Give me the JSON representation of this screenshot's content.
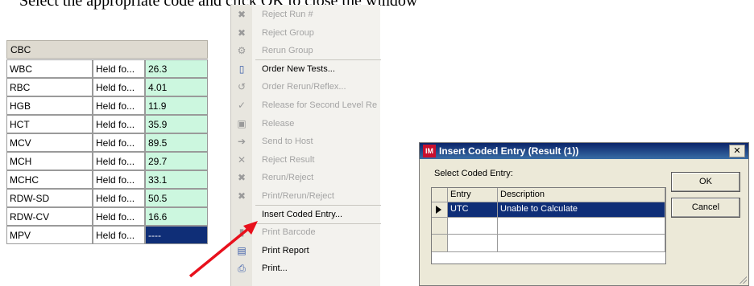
{
  "instruction": "Select the appropriate code and click OK to close the window",
  "cbc_panel": {
    "header": "CBC",
    "rows": [
      {
        "name": "WBC",
        "status": "Held fo...",
        "value": "26.3"
      },
      {
        "name": "RBC",
        "status": "Held fo...",
        "value": "4.01"
      },
      {
        "name": "HGB",
        "status": "Held fo...",
        "value": "11.9"
      },
      {
        "name": "HCT",
        "status": "Held fo...",
        "value": "35.9"
      },
      {
        "name": "MCV",
        "status": "Held fo...",
        "value": "89.5"
      },
      {
        "name": "MCH",
        "status": "Held fo...",
        "value": "29.7"
      },
      {
        "name": "MCHC",
        "status": "Held fo...",
        "value": "33.1"
      },
      {
        "name": "RDW-SD",
        "status": "Held fo...",
        "value": "50.5"
      },
      {
        "name": "RDW-CV",
        "status": "Held fo...",
        "value": "16.6"
      },
      {
        "name": "MPV",
        "status": "Held fo...",
        "value": "----",
        "selected": true
      }
    ]
  },
  "context_menu": {
    "items": [
      {
        "label": "Reject Run #",
        "enabled": false,
        "icon": "reject-run-icon",
        "glyph": "✖"
      },
      {
        "label": "Reject Group",
        "enabled": false,
        "icon": "reject-group-icon",
        "glyph": "✖"
      },
      {
        "label": "Rerun Group",
        "enabled": false,
        "icon": "rerun-group-icon",
        "glyph": "⚙"
      },
      {
        "label": "Order New Tests...",
        "enabled": true,
        "icon": "new-document-icon",
        "glyph": "▯"
      },
      {
        "label": "Order Rerun/Reflex...",
        "enabled": false,
        "icon": "rerun-reflex-icon",
        "glyph": "↺"
      },
      {
        "label": "Release for Second Level Re",
        "enabled": false,
        "icon": "checkmark-icon",
        "glyph": "✓"
      },
      {
        "label": "Release",
        "enabled": false,
        "icon": "release-icon",
        "glyph": "▣"
      },
      {
        "label": "Send to Host",
        "enabled": false,
        "icon": "send-to-host-icon",
        "glyph": "➔"
      },
      {
        "label": "Reject Result",
        "enabled": false,
        "icon": "reject-result-icon",
        "glyph": "✕"
      },
      {
        "label": "Rerun/Reject",
        "enabled": false,
        "icon": "rerun-reject-icon",
        "glyph": "✖"
      },
      {
        "label": "Print/Rerun/Reject",
        "enabled": false,
        "icon": "print-rerun-reject-icon",
        "glyph": "✖"
      },
      {
        "label": "Insert Coded Entry...",
        "enabled": true,
        "icon": "",
        "glyph": ""
      },
      {
        "label": "Print Barcode",
        "enabled": false,
        "icon": "barcode-icon",
        "glyph": "▮"
      },
      {
        "label": "Print Report",
        "enabled": true,
        "icon": "print-report-icon",
        "glyph": "▤"
      },
      {
        "label": "Print...",
        "enabled": true,
        "icon": "printer-icon",
        "glyph": "⎙"
      }
    ]
  },
  "dialog": {
    "app_icon_text": "IM",
    "title": "Insert Coded Entry (Result (1))",
    "close_label": "✕",
    "prompt": "Select Coded Entry:",
    "columns": [
      "Entry",
      "Description"
    ],
    "rows": [
      {
        "entry": "UTC",
        "description": "Unable to Calculate",
        "selected": true
      }
    ],
    "ok_label": "OK",
    "cancel_label": "Cancel"
  },
  "colors": {
    "value_cell_bg": "#ccf7df",
    "selection_bg": "#0f2e77",
    "arrow": "#e8101c",
    "titlebar": "#0a246a"
  }
}
